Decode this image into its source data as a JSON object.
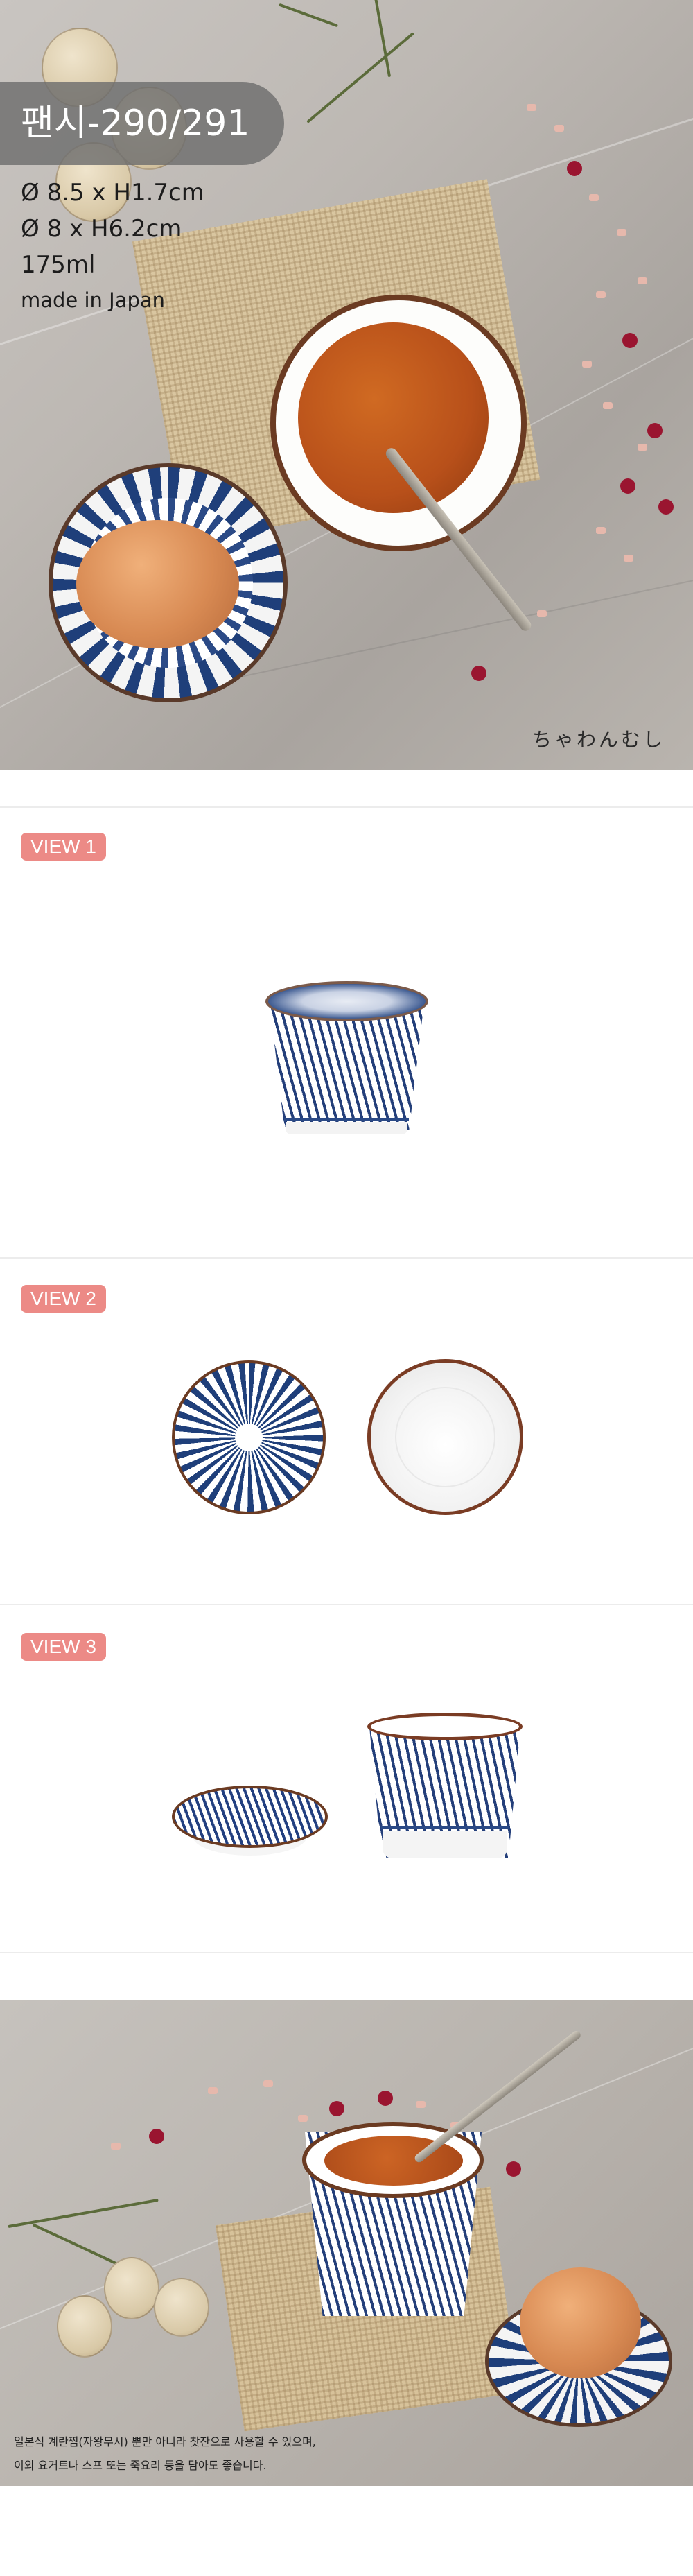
{
  "product": {
    "title": "팬시-290/291",
    "specs": [
      "Ø 8.5 x H1.7cm",
      "Ø 8 x H6.2cm",
      "175ml"
    ],
    "origin": "made in Japan",
    "hero_caption": "ちゃわんむし"
  },
  "views": [
    {
      "label": "VIEW 1"
    },
    {
      "label": "VIEW 2"
    },
    {
      "label": "VIEW 3"
    }
  ],
  "description": [
    "일본식 계란찜(자왕무시) 뿐만 아니라 찻잔으로 사용할 수 있으며,",
    "이외 요거트나 스프 또는 죽요리 등을 담아도 좋습니다."
  ],
  "colors": {
    "badge": "#ec8a86",
    "pattern_blue": "#243f7a",
    "rim_brown": "#6b3b22"
  }
}
